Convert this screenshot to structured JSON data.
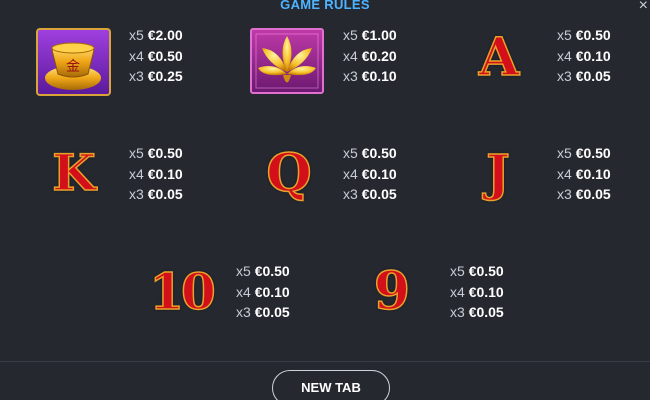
{
  "header": {
    "title": "GAME RULES",
    "close_glyph": "×"
  },
  "symbols": [
    {
      "name": "gold-ingot",
      "icon": "gold-ingot-icon",
      "pays": [
        {
          "mult": "x5",
          "value": "€2.00"
        },
        {
          "mult": "x4",
          "value": "€0.50"
        },
        {
          "mult": "x3",
          "value": "€0.25"
        }
      ]
    },
    {
      "name": "lotus",
      "icon": "lotus-icon",
      "pays": [
        {
          "mult": "x5",
          "value": "€1.00"
        },
        {
          "mult": "x4",
          "value": "€0.20"
        },
        {
          "mult": "x3",
          "value": "€0.10"
        }
      ]
    },
    {
      "name": "A",
      "glyph": "A",
      "pays": [
        {
          "mult": "x5",
          "value": "€0.50"
        },
        {
          "mult": "x4",
          "value": "€0.10"
        },
        {
          "mult": "x3",
          "value": "€0.05"
        }
      ]
    },
    {
      "name": "K",
      "glyph": "K",
      "pays": [
        {
          "mult": "x5",
          "value": "€0.50"
        },
        {
          "mult": "x4",
          "value": "€0.10"
        },
        {
          "mult": "x3",
          "value": "€0.05"
        }
      ]
    },
    {
      "name": "Q",
      "glyph": "Q",
      "pays": [
        {
          "mult": "x5",
          "value": "€0.50"
        },
        {
          "mult": "x4",
          "value": "€0.10"
        },
        {
          "mult": "x3",
          "value": "€0.05"
        }
      ]
    },
    {
      "name": "J",
      "glyph": "J",
      "pays": [
        {
          "mult": "x5",
          "value": "€0.50"
        },
        {
          "mult": "x4",
          "value": "€0.10"
        },
        {
          "mult": "x3",
          "value": "€0.05"
        }
      ]
    },
    {
      "name": "10",
      "glyph": "10",
      "pays": [
        {
          "mult": "x5",
          "value": "€0.50"
        },
        {
          "mult": "x4",
          "value": "€0.10"
        },
        {
          "mult": "x3",
          "value": "€0.05"
        }
      ]
    },
    {
      "name": "9",
      "glyph": "9",
      "pays": [
        {
          "mult": "x5",
          "value": "€0.50"
        },
        {
          "mult": "x4",
          "value": "€0.10"
        },
        {
          "mult": "x3",
          "value": "€0.05"
        }
      ]
    }
  ],
  "footer": {
    "new_tab_label": "NEW TAB"
  },
  "colors": {
    "accent": "#4db4ff",
    "background": "#262830",
    "letter_red": "#d3101a",
    "letter_gold": "#e8a12a"
  }
}
